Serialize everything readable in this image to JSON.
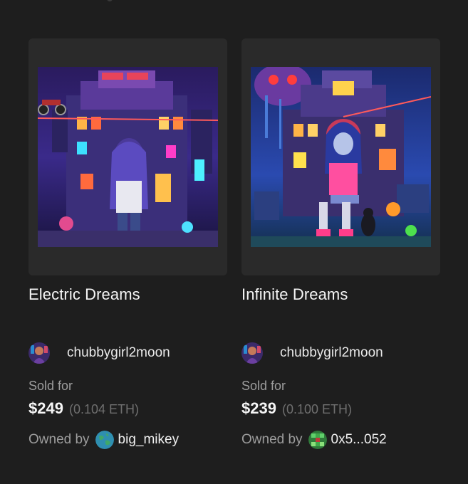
{
  "cards": [
    {
      "title": "Electric Dreams",
      "creator": {
        "name": "chubbygirl2moon",
        "avatar_icon": "creator-avatar-icon"
      },
      "sold_label": "Sold for",
      "price_usd": "$249",
      "price_eth": "(0.104 ETH)",
      "owner_label": "Owned by",
      "owner": {
        "name": "big_mikey",
        "avatar_icon": "earth-globe-avatar-icon"
      }
    },
    {
      "title": "Infinite Dreams",
      "creator": {
        "name": "chubbygirl2moon",
        "avatar_icon": "creator-avatar-icon"
      },
      "sold_label": "Sold for",
      "price_usd": "$239",
      "price_eth": "(0.100 ETH)",
      "owner_label": "Owned by",
      "owner": {
        "name": "0x5...052",
        "avatar_icon": "pixel-green-avatar-icon"
      }
    }
  ],
  "colors": {
    "background": "#1e1e1e",
    "card_frame": "#2a2a2a",
    "text_primary": "#f5f5f5",
    "text_secondary": "#9d9d9d",
    "text_muted": "#6f6f6f"
  }
}
